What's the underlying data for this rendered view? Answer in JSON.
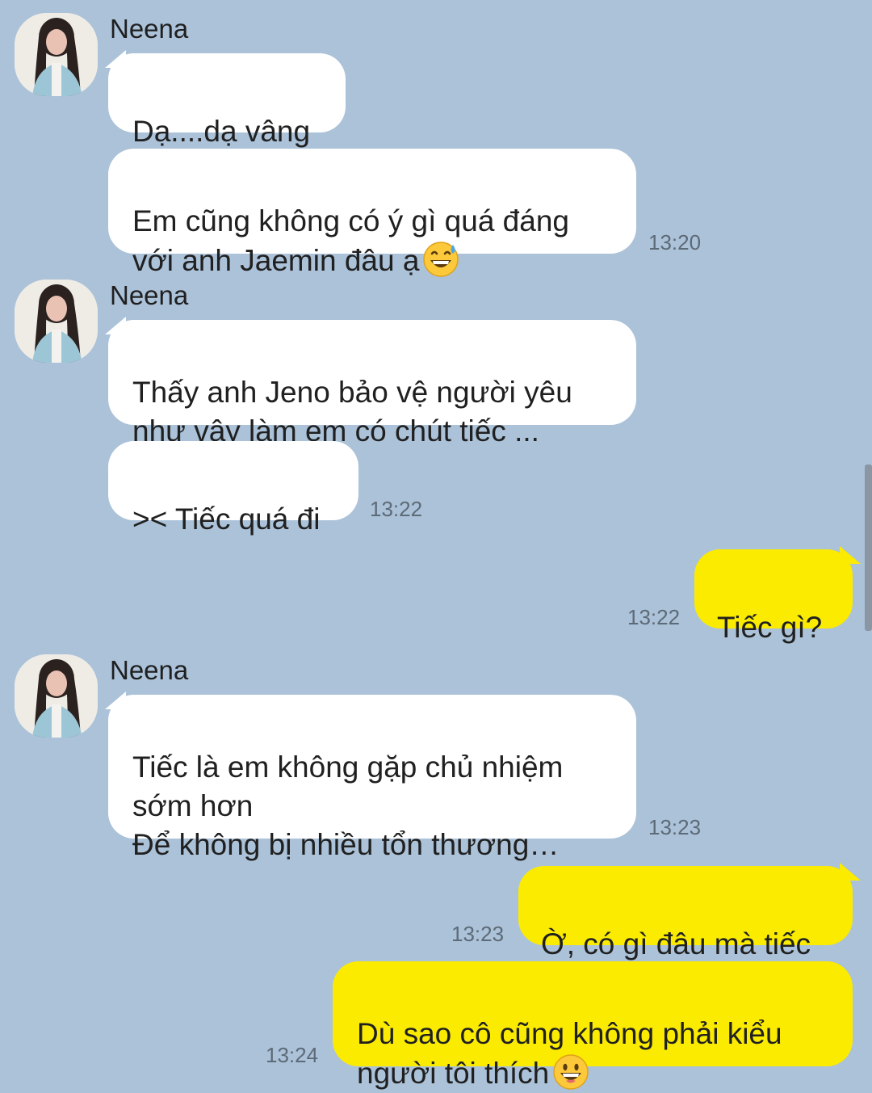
{
  "chat": {
    "messages": [
      {
        "sender": "Neena",
        "text": "Dạ....dạ vâng"
      },
      {
        "text": "Em cũng không có ý gì quá đáng\nvới anh Jaemin đâu ạ",
        "emoji": "grinning-sweat-emoji",
        "time": "13:20"
      },
      {
        "sender": "Neena",
        "text": "Thấy anh Jeno bảo vệ người yêu\nnhư vậy làm em có chút tiếc ..."
      },
      {
        "text": ">< Tiếc quá đi",
        "time": "13:22"
      },
      {
        "text": "Tiếc gì?",
        "time": "13:22",
        "own": true
      },
      {
        "sender": "Neena",
        "text": "Tiếc là em không gặp chủ nhiệm\nsớm hơn\nĐể không bị nhiều tổn thương…",
        "time": "13:23"
      },
      {
        "text": "Ờ, có gì đâu mà tiếc",
        "time": "13:23",
        "own": true
      },
      {
        "text": "Dù sao cô cũng không phải kiểu\nngười tôi thích",
        "emoji": "grinning-emoji",
        "time": "13:24",
        "own": true
      }
    ]
  },
  "colors": {
    "background": "#abc2d9",
    "incoming_bubble": "#ffffff",
    "outgoing_bubble": "#fbeb00",
    "timestamp": "#5d6a77"
  },
  "icons": {
    "avatar": "avatar-photo-icon"
  }
}
